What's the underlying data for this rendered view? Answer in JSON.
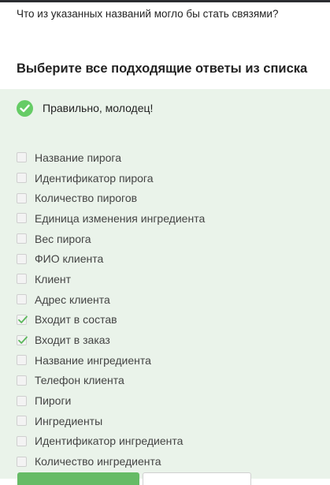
{
  "question": "Что из указанных названий могло бы стать связями?",
  "instruction": "Выберите все подходящие ответы из списка",
  "feedback": {
    "text": "Правильно, молодец!",
    "status_color": "#66cc66"
  },
  "colors": {
    "accent_green": "#66bb66",
    "panel_background": "#eaf3ea",
    "check_green": "#5cb85c"
  },
  "options": [
    {
      "label": "Название пирога",
      "checked": false
    },
    {
      "label": "Идентификатор пирога",
      "checked": false
    },
    {
      "label": "Количество пирогов",
      "checked": false
    },
    {
      "label": "Единица изменения ингредиента",
      "checked": false
    },
    {
      "label": "Вес пирога",
      "checked": false
    },
    {
      "label": "ФИО клиента",
      "checked": false
    },
    {
      "label": "Клиент",
      "checked": false
    },
    {
      "label": "Адрес клиента",
      "checked": false
    },
    {
      "label": "Входит в состав",
      "checked": true
    },
    {
      "label": "Входит в заказ",
      "checked": true
    },
    {
      "label": "Название ингредиента",
      "checked": false
    },
    {
      "label": "Телефон клиента",
      "checked": false
    },
    {
      "label": "Пироги",
      "checked": false
    },
    {
      "label": "Ингредиенты",
      "checked": false
    },
    {
      "label": "Идентификатор ингредиента",
      "checked": false
    },
    {
      "label": "Количество ингредиента",
      "checked": false
    }
  ]
}
